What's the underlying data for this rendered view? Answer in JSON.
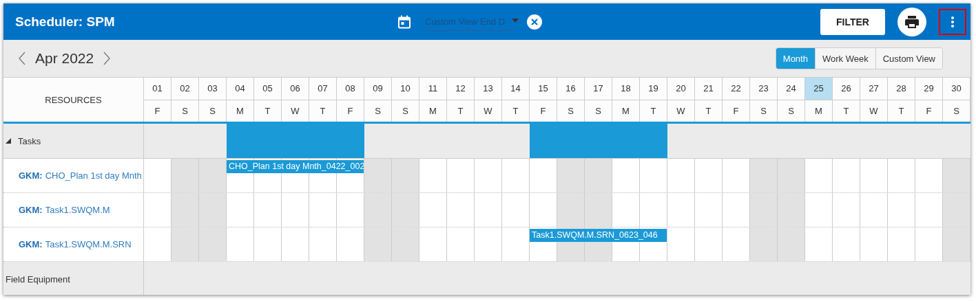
{
  "header": {
    "title": "Scheduler: SPM",
    "date_field": {
      "placeholder": "Custom View End D"
    },
    "filter_button": "FILTER",
    "more_button": {
      "highlighted": true
    }
  },
  "toolbar": {
    "period": "Apr 2022",
    "views": [
      {
        "label": "Month",
        "selected": true
      },
      {
        "label": "Work Week",
        "selected": false
      },
      {
        "label": "Custom View",
        "selected": false
      }
    ]
  },
  "grid": {
    "resources_heading": "RESOURCES",
    "days": [
      {
        "date": "01",
        "weekday": "F",
        "weekend": false,
        "today": false
      },
      {
        "date": "02",
        "weekday": "S",
        "weekend": true,
        "today": false
      },
      {
        "date": "03",
        "weekday": "S",
        "weekend": true,
        "today": false
      },
      {
        "date": "04",
        "weekday": "M",
        "weekend": false,
        "today": false
      },
      {
        "date": "05",
        "weekday": "T",
        "weekend": false,
        "today": false
      },
      {
        "date": "06",
        "weekday": "W",
        "weekend": false,
        "today": false
      },
      {
        "date": "07",
        "weekday": "T",
        "weekend": false,
        "today": false
      },
      {
        "date": "08",
        "weekday": "F",
        "weekend": false,
        "today": false
      },
      {
        "date": "09",
        "weekday": "S",
        "weekend": true,
        "today": false
      },
      {
        "date": "10",
        "weekday": "S",
        "weekend": true,
        "today": false
      },
      {
        "date": "11",
        "weekday": "M",
        "weekend": false,
        "today": false
      },
      {
        "date": "12",
        "weekday": "T",
        "weekend": false,
        "today": false
      },
      {
        "date": "13",
        "weekday": "W",
        "weekend": false,
        "today": false
      },
      {
        "date": "14",
        "weekday": "T",
        "weekend": false,
        "today": false
      },
      {
        "date": "15",
        "weekday": "F",
        "weekend": false,
        "today": false
      },
      {
        "date": "16",
        "weekday": "S",
        "weekend": true,
        "today": false
      },
      {
        "date": "17",
        "weekday": "S",
        "weekend": true,
        "today": false
      },
      {
        "date": "18",
        "weekday": "M",
        "weekend": false,
        "today": false
      },
      {
        "date": "19",
        "weekday": "T",
        "weekend": false,
        "today": false
      },
      {
        "date": "20",
        "weekday": "W",
        "weekend": false,
        "today": false
      },
      {
        "date": "21",
        "weekday": "T",
        "weekend": false,
        "today": false
      },
      {
        "date": "22",
        "weekday": "F",
        "weekend": false,
        "today": false
      },
      {
        "date": "23",
        "weekday": "S",
        "weekend": true,
        "today": false
      },
      {
        "date": "24",
        "weekday": "S",
        "weekend": true,
        "today": false
      },
      {
        "date": "25",
        "weekday": "M",
        "weekend": false,
        "today": true
      },
      {
        "date": "26",
        "weekday": "T",
        "weekend": false,
        "today": false
      },
      {
        "date": "27",
        "weekday": "W",
        "weekend": false,
        "today": false
      },
      {
        "date": "28",
        "weekday": "T",
        "weekend": false,
        "today": false
      },
      {
        "date": "29",
        "weekday": "F",
        "weekend": false,
        "today": false
      },
      {
        "date": "30",
        "weekday": "S",
        "weekend": true,
        "today": false
      }
    ],
    "groups": [
      {
        "name": "Tasks",
        "expanded": true,
        "children": [
          {
            "prefix": "GKM:",
            "name": "CHO_Plan 1st day Mnth",
            "cells": [
              {
                "booked": false
              },
              {
                "booked": false
              },
              {
                "booked": false
              },
              {
                "booked": true,
                "event": "CHO_Plan 1st day Mnth_0422_002"
              },
              {
                "booked": true
              },
              {
                "booked": true
              },
              {
                "booked": true
              },
              {
                "booked": true
              },
              {
                "booked": false
              },
              {
                "booked": false
              },
              {
                "booked": false
              },
              {
                "booked": false
              },
              {
                "booked": false
              },
              {
                "booked": false
              },
              {
                "booked": false
              },
              {
                "booked": false
              },
              {
                "booked": false
              },
              {
                "booked": false
              },
              {
                "booked": false
              },
              {
                "booked": false
              },
              {
                "booked": false
              },
              {
                "booked": false
              },
              {
                "booked": false
              },
              {
                "booked": false
              },
              {
                "booked": false
              },
              {
                "booked": false
              },
              {
                "booked": false
              },
              {
                "booked": false
              },
              {
                "booked": false
              },
              {
                "booked": false
              }
            ]
          },
          {
            "prefix": "GKM:",
            "name": "Task1.SWQM.M",
            "cells": [
              {
                "booked": false
              },
              {
                "booked": false
              },
              {
                "booked": false
              },
              {
                "booked": false
              },
              {
                "booked": false
              },
              {
                "booked": false
              },
              {
                "booked": false
              },
              {
                "booked": false
              },
              {
                "booked": false
              },
              {
                "booked": false
              },
              {
                "booked": false
              },
              {
                "booked": false
              },
              {
                "booked": false
              },
              {
                "booked": false
              },
              {
                "booked": false
              },
              {
                "booked": false
              },
              {
                "booked": false
              },
              {
                "booked": false
              },
              {
                "booked": false
              },
              {
                "booked": false
              },
              {
                "booked": false
              },
              {
                "booked": false
              },
              {
                "booked": false
              },
              {
                "booked": false
              },
              {
                "booked": false
              },
              {
                "booked": false
              },
              {
                "booked": false
              },
              {
                "booked": false
              },
              {
                "booked": false
              },
              {
                "booked": false
              }
            ]
          },
          {
            "prefix": "GKM:",
            "name": "Task1.SWQM.M.SRN",
            "cells": [
              {
                "booked": false
              },
              {
                "booked": false
              },
              {
                "booked": false
              },
              {
                "booked": false
              },
              {
                "booked": false
              },
              {
                "booked": false
              },
              {
                "booked": false
              },
              {
                "booked": false
              },
              {
                "booked": false
              },
              {
                "booked": false
              },
              {
                "booked": false
              },
              {
                "booked": false
              },
              {
                "booked": false
              },
              {
                "booked": false
              },
              {
                "booked": true,
                "event": "Task1.SWQM.M.SRN_0623_046"
              },
              {
                "booked": true
              },
              {
                "booked": true
              },
              {
                "booked": true
              },
              {
                "booked": true
              },
              {
                "booked": false
              },
              {
                "booked": false
              },
              {
                "booked": false
              },
              {
                "booked": false
              },
              {
                "booked": false
              },
              {
                "booked": false
              },
              {
                "booked": false
              },
              {
                "booked": false
              },
              {
                "booked": false
              },
              {
                "booked": false
              },
              {
                "booked": false
              }
            ]
          }
        ]
      },
      {
        "name": "Field Equipment"
      }
    ]
  }
}
